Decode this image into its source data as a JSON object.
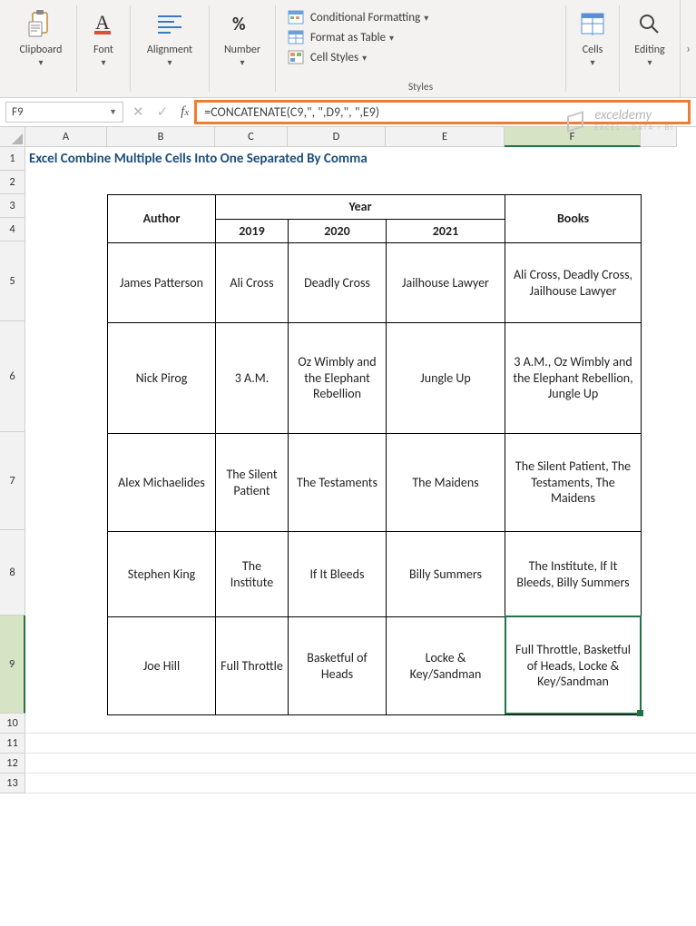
{
  "ribbon": {
    "clipboard": {
      "label": "Clipboard"
    },
    "font": {
      "label": "Font"
    },
    "alignment": {
      "label": "Alignment"
    },
    "number": {
      "label": "Number"
    },
    "styles": {
      "group_label": "Styles",
      "conditional": "Conditional Formatting",
      "as_table": "Format as Table",
      "cell_styles": "Cell Styles"
    },
    "cells": {
      "label": "Cells"
    },
    "editing": {
      "label": "Editing"
    }
  },
  "name_box": "F9",
  "formula": "=CONCATENATE(C9,\", \",D9,\", \",E9)",
  "columns": [
    "A",
    "B",
    "C",
    "D",
    "E",
    "F"
  ],
  "selected_column": "F",
  "rows": [
    "1",
    "2",
    "3",
    "4",
    "5",
    "6",
    "7",
    "8",
    "9",
    "10",
    "11",
    "12",
    "13"
  ],
  "selected_row": "9",
  "title": "Excel Combine Multiple Cells Into One Separated By Comma",
  "table": {
    "headers": {
      "author": "Author",
      "year": "Year",
      "books": "Books"
    },
    "year_sub": [
      "2019",
      "2020",
      "2021"
    ],
    "rows": [
      {
        "author": "James Patterson",
        "c2019": "Ali Cross",
        "c2020": "Deadly Cross",
        "c2021": "Jailhouse Lawyer",
        "books": "Ali Cross, Deadly Cross, Jailhouse Lawyer"
      },
      {
        "author": "Nick Pirog",
        "c2019": "3 A.M.",
        "c2020": "Oz Wimbly and the Elephant Rebellion",
        "c2021": "Jungle Up",
        "books": "3 A.M., Oz Wimbly and the Elephant Rebellion, Jungle Up"
      },
      {
        "author": "Alex Michaelides",
        "c2019": "The Silent Patient",
        "c2020": "The Testaments",
        "c2021": "The Maidens",
        "books": "The Silent Patient, The Testaments, The Maidens"
      },
      {
        "author": "Stephen King",
        "c2019": "The Institute",
        "c2020": "If It Bleeds",
        "c2021": "Billy Summers",
        "books": "The Institute, If It Bleeds, Billy Summers"
      },
      {
        "author": "Joe Hill",
        "c2019": "Full Throttle",
        "c2020": "Basketful of Heads",
        "c2021": "Locke & Key/Sandman",
        "books": "Full Throttle, Basketful of Heads, Locke & Key/Sandman"
      }
    ]
  },
  "watermark": {
    "brand": "exceldemy",
    "tag": "EXCEL · DATA · BI"
  },
  "colors": {
    "accent": "#217346",
    "highlight": "#ed7d31",
    "header_blue": "#8ea9db",
    "header_grey": "#d0cece",
    "title_blue": "#1f4e79"
  }
}
